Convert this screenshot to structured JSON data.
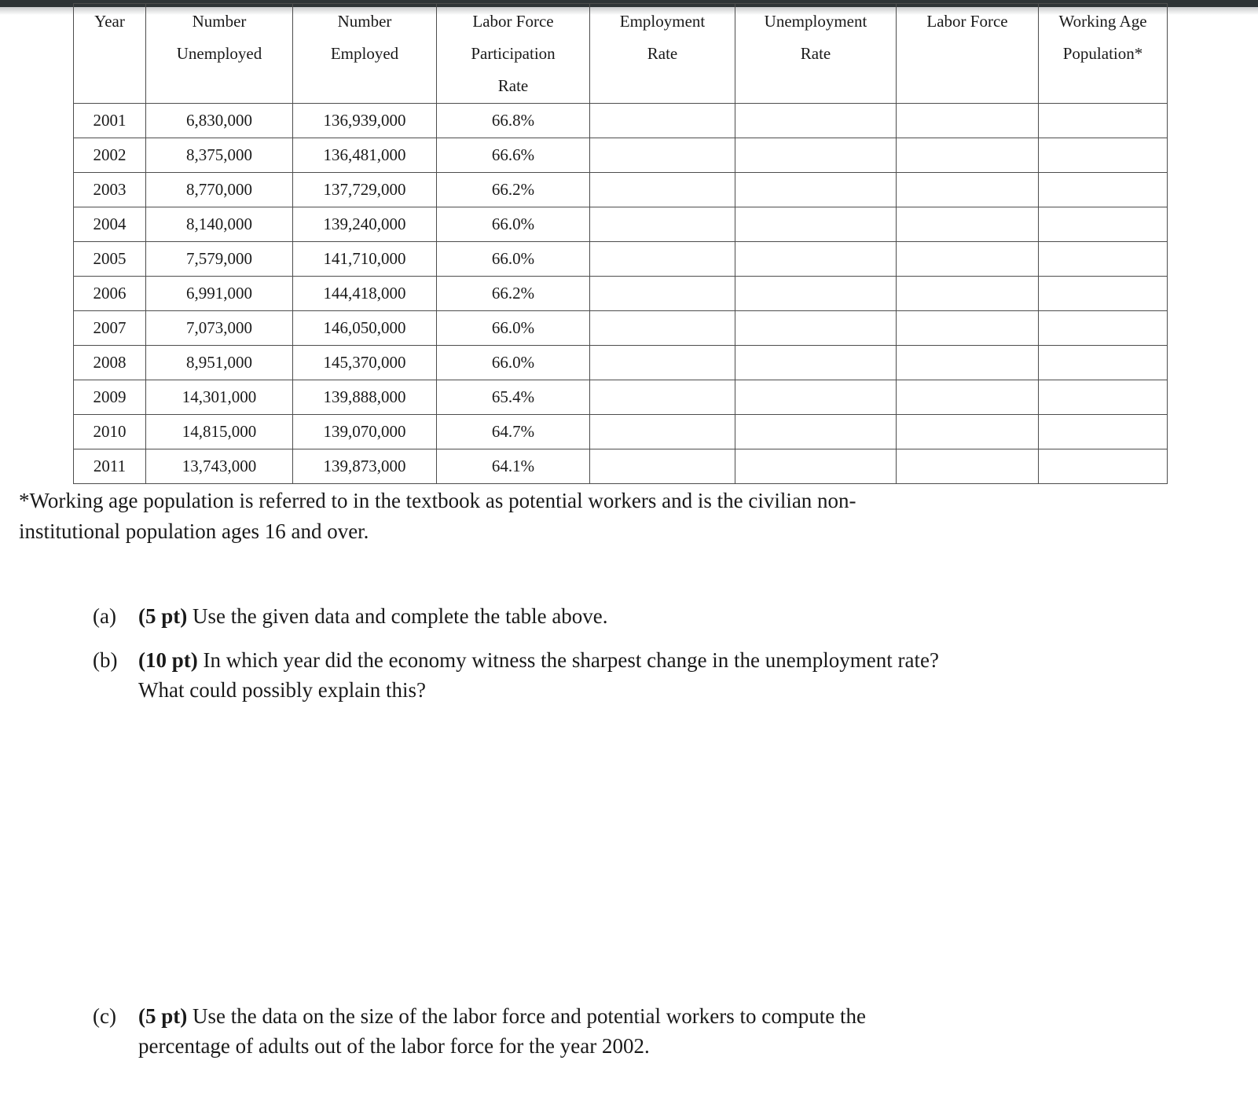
{
  "table": {
    "headers": [
      {
        "lines": [
          "Year"
        ]
      },
      {
        "lines": [
          "Number",
          "Unemployed"
        ]
      },
      {
        "lines": [
          "Number",
          "Employed"
        ]
      },
      {
        "lines": [
          "Labor Force",
          "Participation",
          "Rate"
        ]
      },
      {
        "lines": [
          "Employment",
          "Rate"
        ]
      },
      {
        "lines": [
          "Unemployment",
          "Rate"
        ]
      },
      {
        "lines": [
          "Labor Force"
        ]
      },
      {
        "lines": [
          "Working Age",
          "Population*"
        ]
      }
    ],
    "rows": [
      {
        "year": "2001",
        "number_unemployed": "6,830,000",
        "number_employed": "136,939,000",
        "lfpr": "66.8%",
        "employment_rate": "",
        "unemployment_rate": "",
        "labor_force": "",
        "working_age_population": ""
      },
      {
        "year": "2002",
        "number_unemployed": "8,375,000",
        "number_employed": "136,481,000",
        "lfpr": "66.6%",
        "employment_rate": "",
        "unemployment_rate": "",
        "labor_force": "",
        "working_age_population": ""
      },
      {
        "year": "2003",
        "number_unemployed": "8,770,000",
        "number_employed": "137,729,000",
        "lfpr": "66.2%",
        "employment_rate": "",
        "unemployment_rate": "",
        "labor_force": "",
        "working_age_population": ""
      },
      {
        "year": "2004",
        "number_unemployed": "8,140,000",
        "number_employed": "139,240,000",
        "lfpr": "66.0%",
        "employment_rate": "",
        "unemployment_rate": "",
        "labor_force": "",
        "working_age_population": ""
      },
      {
        "year": "2005",
        "number_unemployed": "7,579,000",
        "number_employed": "141,710,000",
        "lfpr": "66.0%",
        "employment_rate": "",
        "unemployment_rate": "",
        "labor_force": "",
        "working_age_population": ""
      },
      {
        "year": "2006",
        "number_unemployed": "6,991,000",
        "number_employed": "144,418,000",
        "lfpr": "66.2%",
        "employment_rate": "",
        "unemployment_rate": "",
        "labor_force": "",
        "working_age_population": ""
      },
      {
        "year": "2007",
        "number_unemployed": "7,073,000",
        "number_employed": "146,050,000",
        "lfpr": "66.0%",
        "employment_rate": "",
        "unemployment_rate": "",
        "labor_force": "",
        "working_age_population": ""
      },
      {
        "year": "2008",
        "number_unemployed": "8,951,000",
        "number_employed": "145,370,000",
        "lfpr": "66.0%",
        "employment_rate": "",
        "unemployment_rate": "",
        "labor_force": "",
        "working_age_population": ""
      },
      {
        "year": "2009",
        "number_unemployed": "14,301,000",
        "number_employed": "139,888,000",
        "lfpr": "65.4%",
        "employment_rate": "",
        "unemployment_rate": "",
        "labor_force": "",
        "working_age_population": ""
      },
      {
        "year": "2010",
        "number_unemployed": "14,815,000",
        "number_employed": "139,070,000",
        "lfpr": "64.7%",
        "employment_rate": "",
        "unemployment_rate": "",
        "labor_force": "",
        "working_age_population": ""
      },
      {
        "year": "2011",
        "number_unemployed": "13,743,000",
        "number_employed": "139,873,000",
        "lfpr": "64.1%",
        "employment_rate": "",
        "unemployment_rate": "",
        "labor_force": "",
        "working_age_population": ""
      }
    ]
  },
  "footnote": {
    "line1": "*Working age population is referred to in the textbook as potential workers and is the civilian non-",
    "line2": "institutional population ages 16 and over."
  },
  "questions": [
    {
      "label": "(a)",
      "points": "(5 pt)",
      "text": " Use the given data and complete the table above.",
      "line2": ""
    },
    {
      "label": "(b)",
      "points": "(10 pt)",
      "text": " In which year did the economy witness the sharpest change in the unemployment rate?",
      "line2": "What could possibly explain this?"
    }
  ],
  "question_c": {
    "label": "(c)",
    "points": "(5 pt)",
    "text": " Use the data on the size of the labor force and potential workers to compute the",
    "line2": "percentage of adults out of the labor force for the year 2002."
  },
  "colors": {
    "text": "#1a1a1a",
    "rule": "#4d4d4d",
    "top_strip": "#2e3436"
  }
}
